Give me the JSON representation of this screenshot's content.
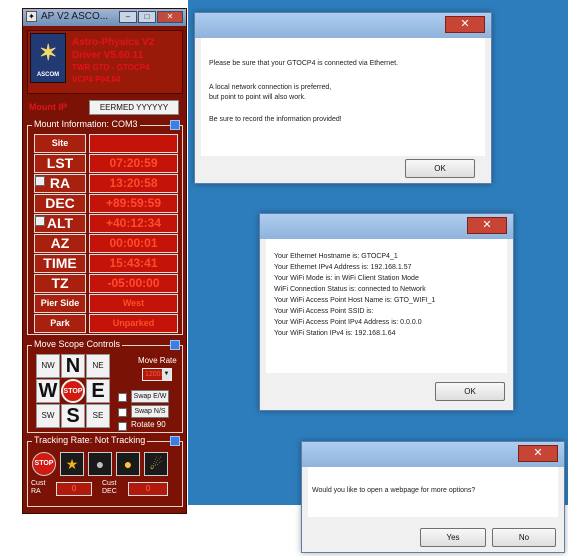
{
  "driver": {
    "title": "AP V2 ASCO...",
    "logo_text": "ASCOM",
    "info_lines": [
      "Astro-Physics V2",
      "Driver V5.60.11",
      "TWR GTO - GTOCP4",
      "VCP4 P04.04"
    ],
    "ip_label": "Mount IP",
    "ip_value": "EERMED YYYYYY",
    "mount_info_title": "Mount Information: COM3",
    "rows": [
      {
        "key": "Site",
        "value": ""
      },
      {
        "key": "LST",
        "value": "07:20:59"
      },
      {
        "key": "RA",
        "value": "13:20:58"
      },
      {
        "key": "DEC",
        "value": "+89:59:59"
      },
      {
        "key": "ALT",
        "value": "+40:12:34"
      },
      {
        "key": "AZ",
        "value": "00:00:01"
      },
      {
        "key": "TIME",
        "value": "15:43:41"
      },
      {
        "key": "TZ",
        "value": "-05:00:00"
      },
      {
        "key": "Pier Side",
        "value": "West"
      },
      {
        "key": "Park",
        "value": "Unparked"
      }
    ],
    "scope_title": "Move Scope Controls",
    "dirs": {
      "nw": "NW",
      "n": "N",
      "ne": "NE",
      "w": "W",
      "stop": "STOP",
      "e": "E",
      "sw": "SW",
      "s": "S",
      "se": "SE"
    },
    "move_rate_label": "Move Rate",
    "move_rate_value": "1200x",
    "swap_ew": "Swap E/W",
    "swap_ns": "Swap N/S",
    "rotate": "Rotate 90",
    "tracking_title": "Tracking Rate: Not Tracking",
    "cust_ra_label": "Cust RA",
    "cust_ra_value": "0",
    "cust_dec_label": "Cust DEC",
    "cust_dec_value": "0"
  },
  "dialog1": {
    "line1": "Please be sure that your GTOCP4 is connected via Ethernet.",
    "line2": "A local network connection is preferred,",
    "line3": "but point to point will also work.",
    "line4": "Be sure to record the information provided!",
    "ok": "OK"
  },
  "dialog2": {
    "lines": [
      "Your Ethernet Hostname is: GTOCP4_1",
      "Your Ethernet IPv4 Address is: 192.168.1.57",
      "Your WiFi Mode is: in WiFi Client Station Mode",
      "WiFi Connection Status is: connected to Network",
      "Your WiFi Access Point Host Name is: GTO_WIFI_1",
      "Your WiFi Access Point SSID is:",
      "Your WiFi Access Point IPv4 Address is: 0.0.0.0",
      "Your WiFi Station IPv4 is: 192.168.1.64"
    ],
    "ok": "OK"
  },
  "dialog3": {
    "question": "Would you like to open a webpage for more options?",
    "yes": "Yes",
    "no": "No"
  }
}
